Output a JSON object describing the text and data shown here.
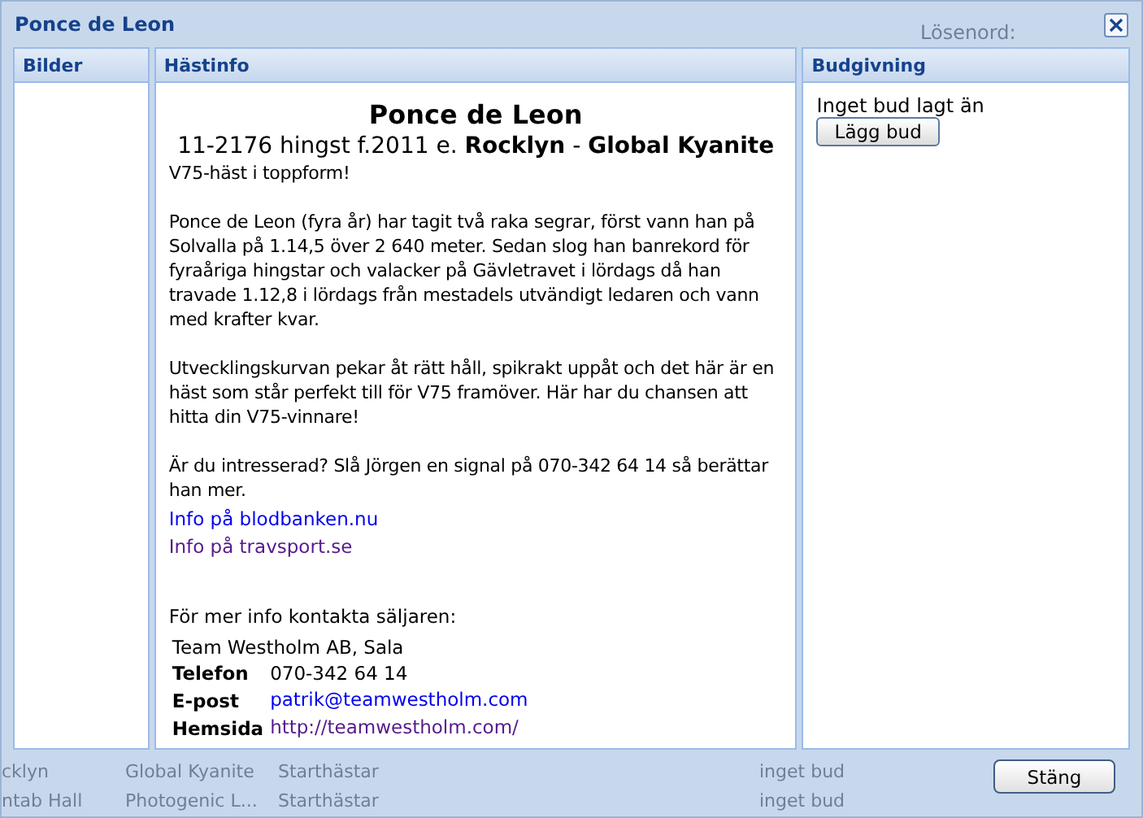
{
  "window": {
    "title": "Ponce de Leon",
    "background_label": "Lösenord:"
  },
  "panels": {
    "images": {
      "title": "Bilder"
    },
    "info": {
      "title": "Hästinfo",
      "heading": "Ponce de Leon",
      "subheading": "11-2176 hingst f.2011 e. **Rocklyn** - **Global Kyanite**",
      "paragraphs": [
        "V75-häst i toppform!",
        "Ponce de Leon (fyra år) har tagit två raka segrar, först vann han på Solvalla på 1.14,5 över 2 640 meter. Sedan slog han banrekord för fyraåriga hingstar och valacker på Gävletravet i lördags då han travade 1.12,8 i lördags från mestadels utvändigt ledaren och vann med krafter kvar.",
        "Utvecklingskurvan pekar åt rätt håll, spikrakt uppåt och det här är en häst som står perfekt till för V75 framöver. Här har du chansen att hitta din V75-vinnare!",
        "Är du intresserad? Slå Jörgen en signal på 070-342 64 14 så berättar han mer."
      ],
      "links": [
        {
          "label": "Info på blodbanken.nu",
          "visited": false
        },
        {
          "label": "Info på travsport.se",
          "visited": true
        }
      ],
      "contact_intro": "För mer info kontakta säljaren:",
      "contact": {
        "company": "Team Westholm AB, Sala",
        "rows": [
          {
            "label": "Telefon",
            "value": "070-342 64 14",
            "kind": "text"
          },
          {
            "label": "E-post",
            "value": "patrik@teamwestholm.com",
            "kind": "link",
            "visited": false
          },
          {
            "label": "Hemsida",
            "value": "http://teamwestholm.com/",
            "kind": "link",
            "visited": true
          }
        ]
      }
    },
    "bidding": {
      "title": "Budgivning",
      "status": "Inget bud lagt än",
      "button": "Lägg bud"
    }
  },
  "background_rows": [
    [
      "cklyn",
      "Global Kyanite",
      "Starthästar",
      "inget bud"
    ],
    [
      "ntab Hall",
      "Photogenic L...",
      "Starthästar",
      "inget bud"
    ]
  ],
  "close_button": "Stäng"
}
